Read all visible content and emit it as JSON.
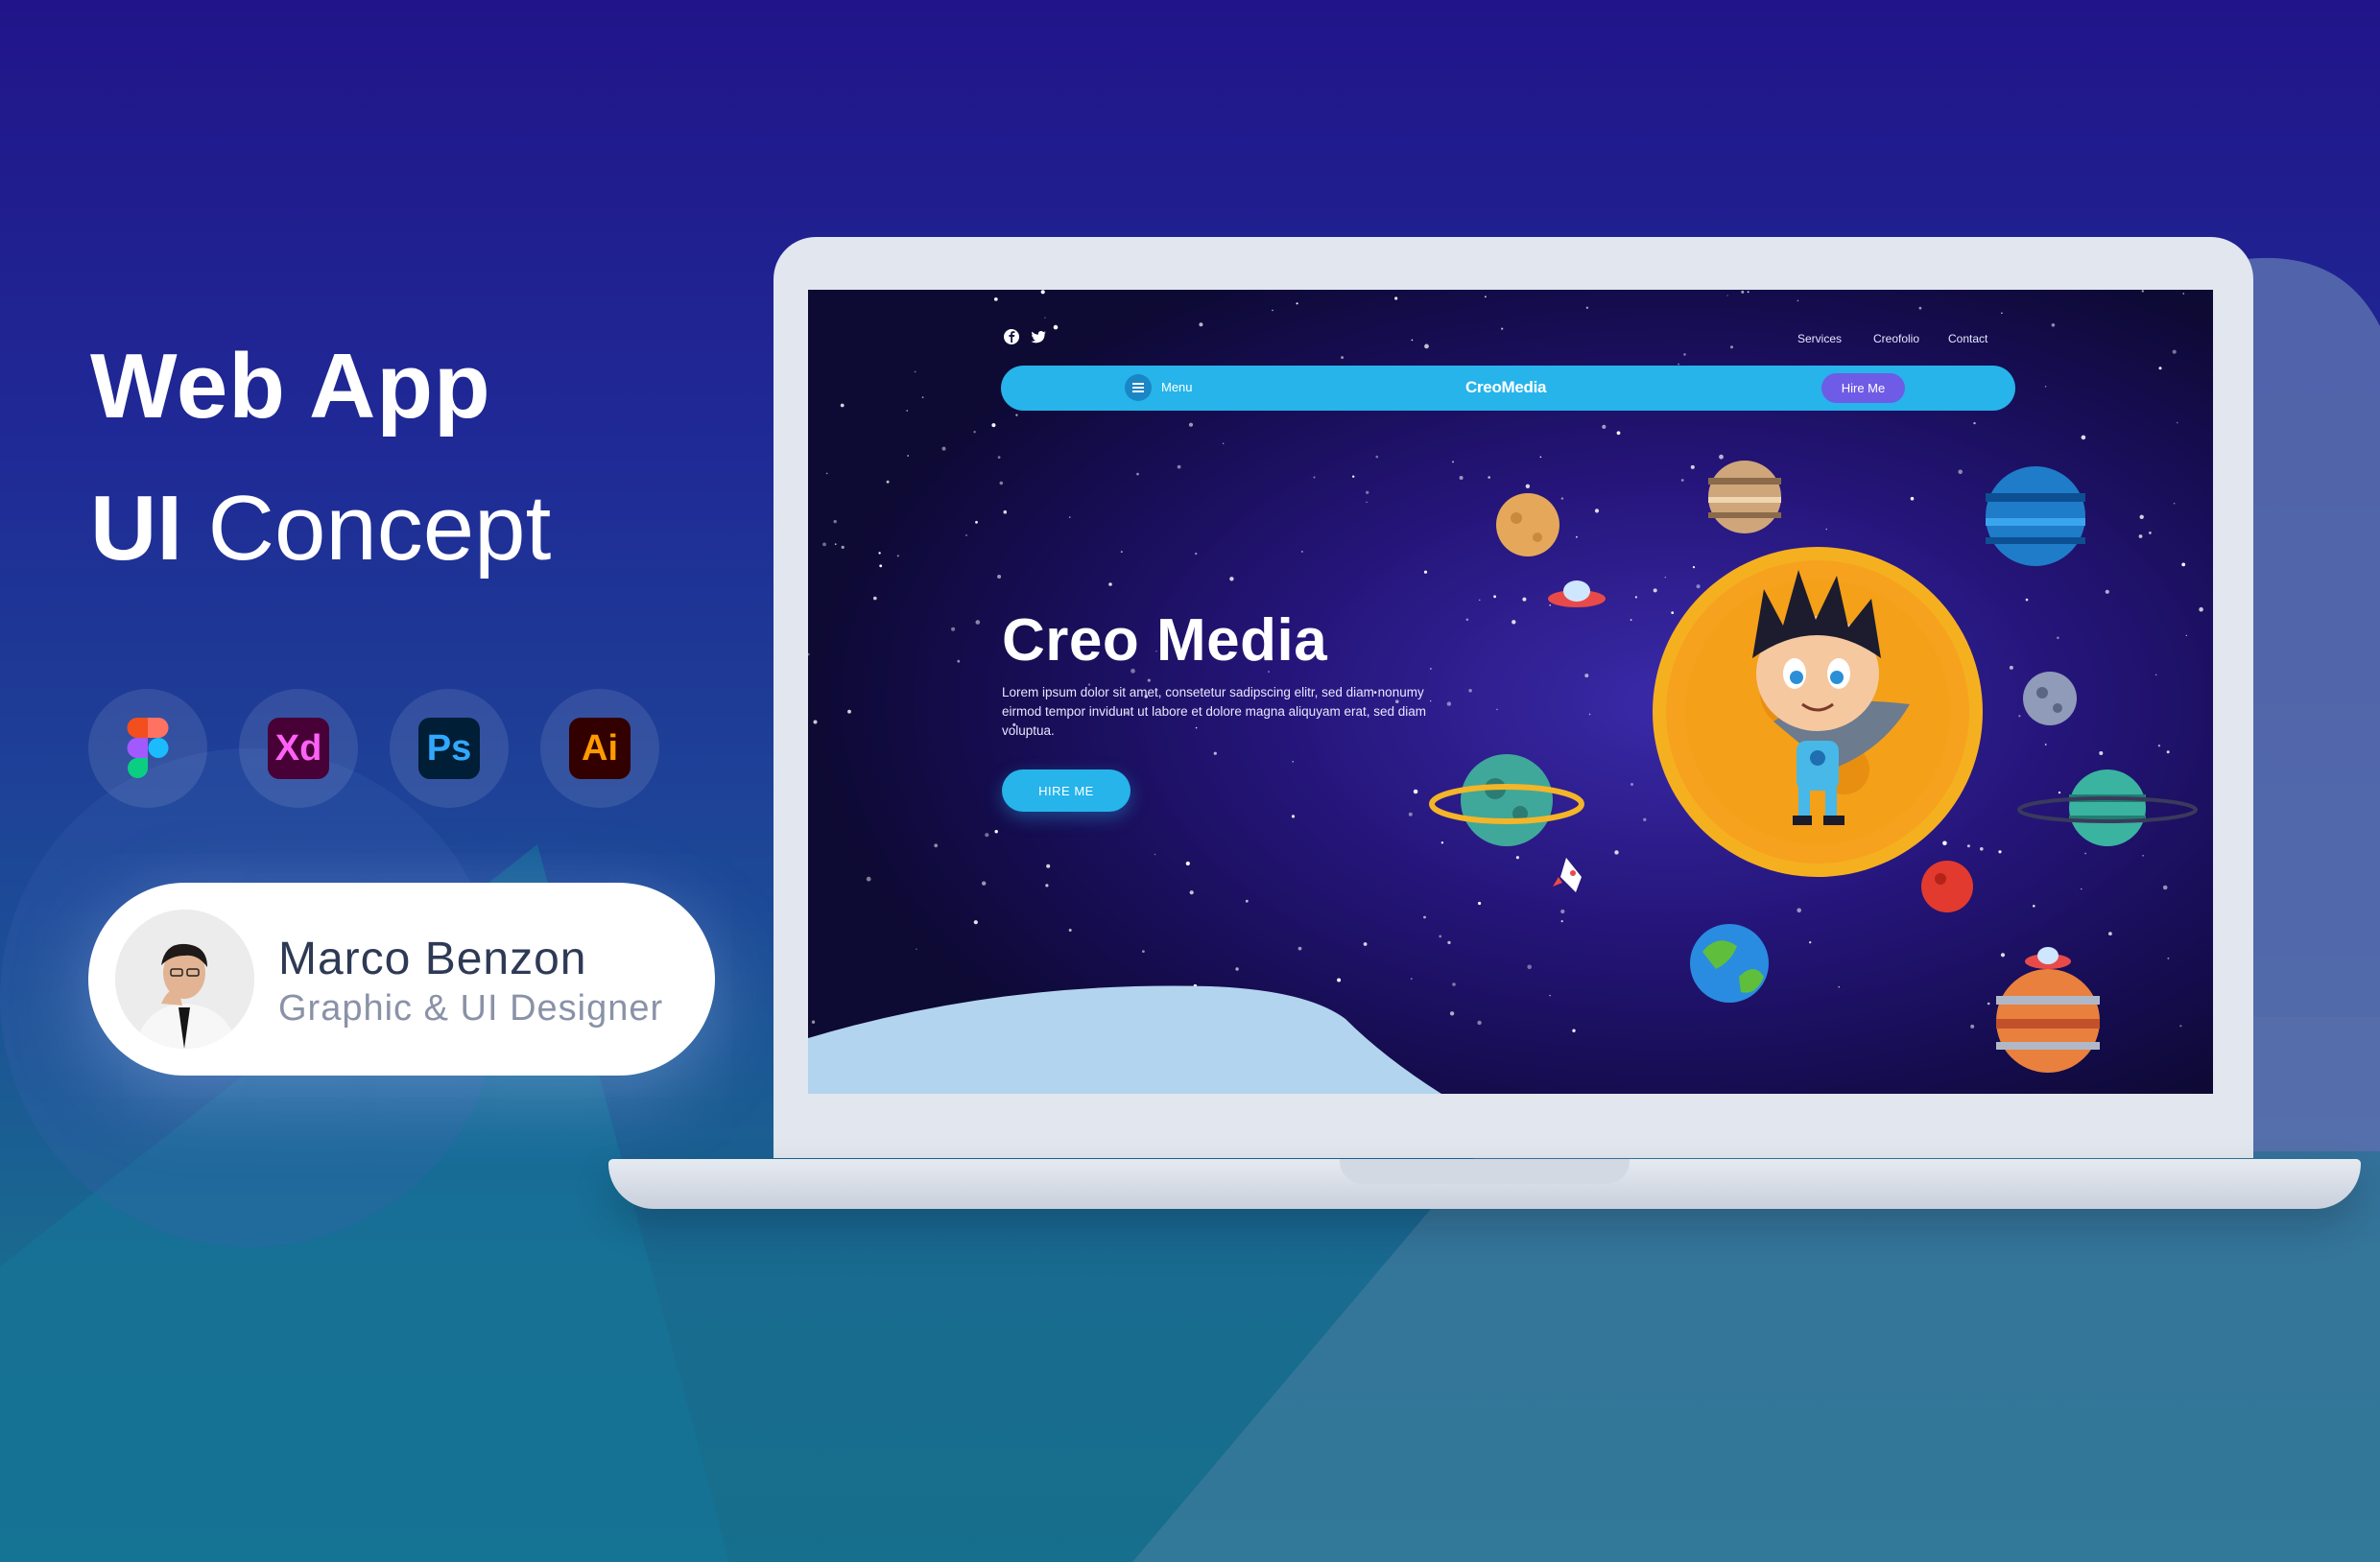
{
  "showcase": {
    "title_line1": "Web App",
    "title_line2_bold": "UI",
    "title_line2_regular": "Concept"
  },
  "tools": [
    {
      "name": "Figma",
      "icon": "figma-icon",
      "label": ""
    },
    {
      "name": "Adobe XD",
      "icon": "xd-icon",
      "label": "Xd"
    },
    {
      "name": "Photoshop",
      "icon": "ps-icon",
      "label": "Ps"
    },
    {
      "name": "Illustrator",
      "icon": "ai-icon",
      "label": "Ai"
    }
  ],
  "designer": {
    "name": "Marco Benzon",
    "role": "Graphic & UI Designer"
  },
  "site": {
    "social": [
      "facebook-icon",
      "twitter-icon"
    ],
    "top_links": [
      "Services",
      "Creofolio",
      "Contact"
    ],
    "nav": {
      "menu_label": "Menu",
      "brand": "CreoMedia",
      "hire_label": "Hire Me"
    },
    "hero": {
      "title": "Creo Media",
      "text": "Lorem ipsum dolor sit amet, consetetur sadipscing elitr, sed diam nonumy eirmod tempor invidunt ut labore et dolore magna aliquyam erat, sed diam voluptua.",
      "cta": "HIRE ME"
    }
  },
  "colors": {
    "accent": "#26b4ea",
    "pill": "#6f5ce6",
    "space": "#1a0f5e",
    "sun": "#f7a21e"
  }
}
